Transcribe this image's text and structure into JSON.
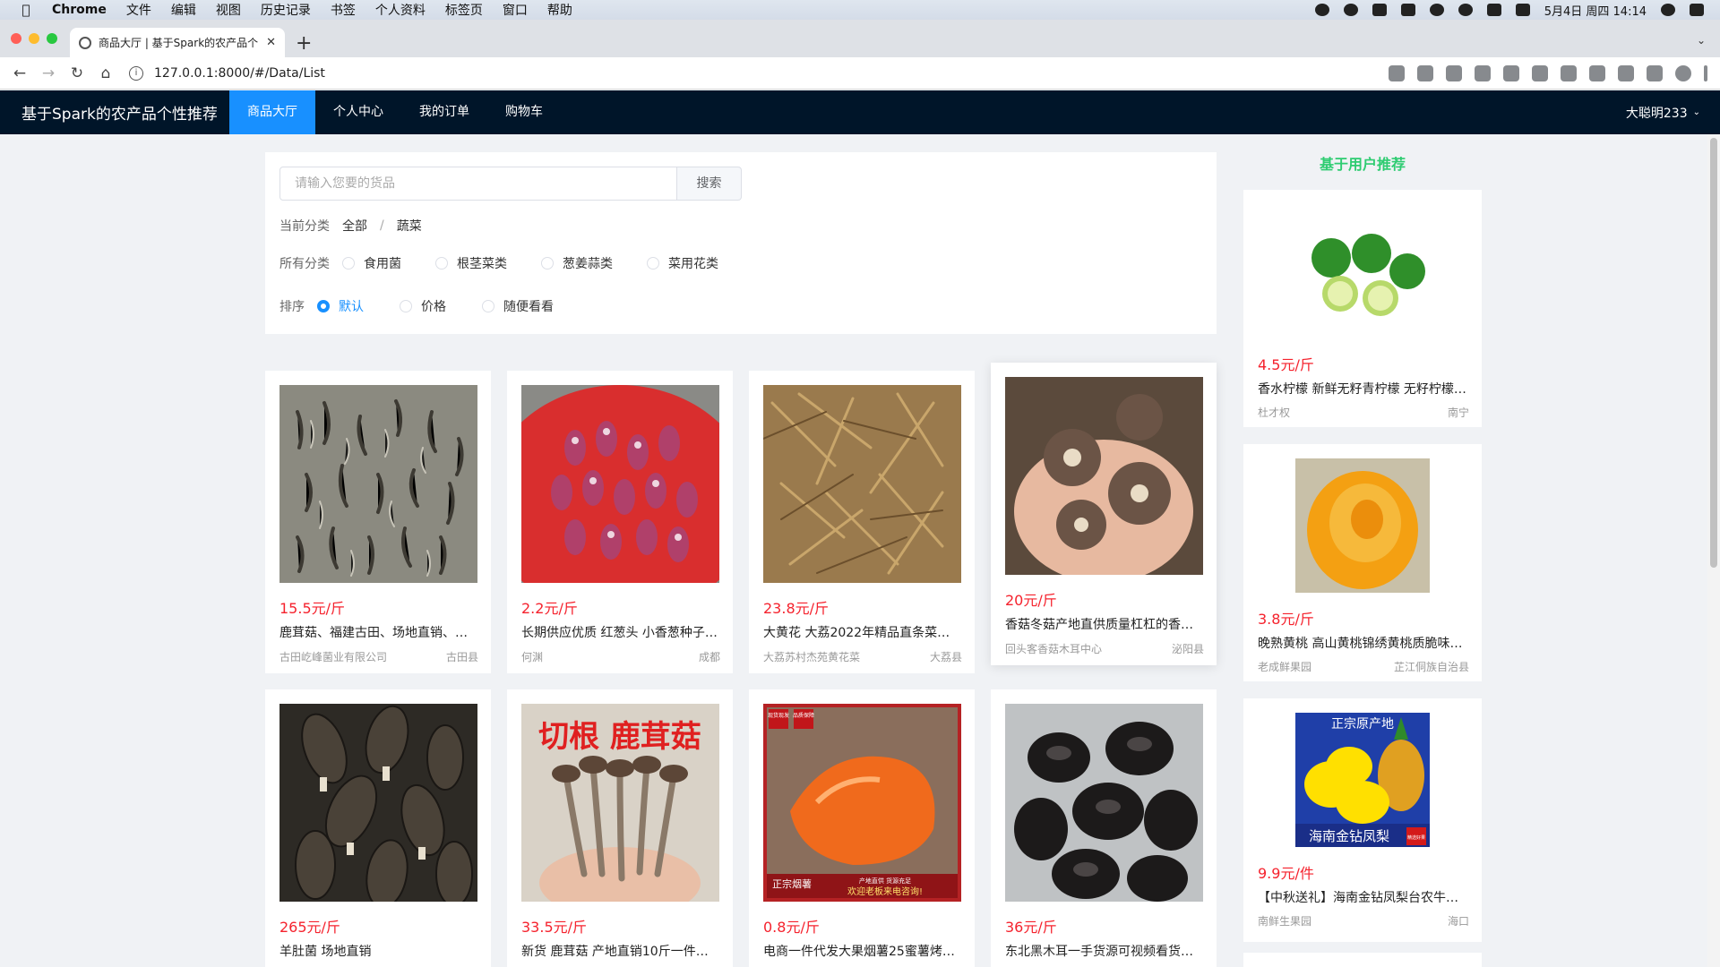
{
  "menubar": {
    "app": "Chrome",
    "items": [
      "文件",
      "编辑",
      "视图",
      "历史记录",
      "书签",
      "个人资料",
      "标签页",
      "窗口",
      "帮助"
    ],
    "clock": "5月4日 周四 14:14"
  },
  "browser": {
    "tab_title": "商品大厅 | 基于Spark的农产品个",
    "url": "127.0.0.1:8000/#/Data/List"
  },
  "nav": {
    "brand": "基于Spark的农产品个性推荐",
    "items": [
      "商品大厅",
      "个人中心",
      "我的订单",
      "购物车"
    ],
    "user": "大聪明233"
  },
  "filter": {
    "search_placeholder": "请输入您要的货品",
    "search_button": "搜索",
    "current_label": "当前分类",
    "crumb_all": "全部",
    "crumb_sep": "/",
    "crumb_current": "蔬菜",
    "all_label": "所有分类",
    "categories": [
      "食用菌",
      "根茎菜类",
      "葱姜蒜类",
      "菜用花类"
    ],
    "sort_label": "排序",
    "sort_options": [
      "默认",
      "价格",
      "随便看看"
    ]
  },
  "products": [
    {
      "price": "15.5元/斤",
      "title": "鹿茸菇、福建古田、场地直销、…",
      "shop": "古田屹峰菌业有限公司",
      "loc": "古田县"
    },
    {
      "price": "2.2元/斤",
      "title": "长期供应优质 红葱头 小香葱种子…",
      "shop": "何渊",
      "loc": "成都"
    },
    {
      "price": "23.8元/斤",
      "title": "大黄花 大荔2022年精品直条菜已…",
      "shop": "大荔苏村杰苑黄花菜",
      "loc": "大荔县"
    },
    {
      "price": "20元/斤",
      "title": "香菇冬菇产地直供质量杠杠的香…",
      "shop": "回头客香菇木耳中心",
      "loc": "泌阳县"
    },
    {
      "price": "265元/斤",
      "title": "羊肚菌 场地直销",
      "shop": "",
      "loc": ""
    },
    {
      "price": "33.5元/斤",
      "title": "新货 鹿茸菇 产地直销10斤一件鲜…",
      "shop": "",
      "loc": ""
    },
    {
      "price": "0.8元/斤",
      "title": "电商一件代发大果烟薯25蜜薯烤…",
      "shop": "",
      "loc": ""
    },
    {
      "price": "36元/斤",
      "title": "东北黑木耳一手货源可视频看货…",
      "shop": "",
      "loc": ""
    }
  ],
  "image_texts": {
    "mushroom_banner": "切根 鹿茸菇",
    "potato_tag1": "现货现发",
    "potato_tag2": "品质保障",
    "potato_bottom": "正宗烟薯",
    "potato_mid": "产地直供 货源充足",
    "potato_caption": "欢迎老板来电咨询!",
    "pineapple_top": "正宗原产地",
    "pineapple_bottom": "海南金钻凤梨",
    "pineapple_badge": "精选好果"
  },
  "recommend": {
    "heading": "基于用户推荐",
    "items": [
      {
        "price": "4.5元/斤",
        "title": "香水柠檬 新鲜无籽青柠檬 无籽柠檬…",
        "shop": "杜才权",
        "loc": "南宁"
      },
      {
        "price": "3.8元/斤",
        "title": "晚熟黄桃 高山黄桃锦绣黄桃质脆味…",
        "shop": "老成鲜果园",
        "loc": "芷江侗族自治县"
      },
      {
        "price": "9.9元/件",
        "title": "【中秋送礼】海南金钻凤梨台农牛…",
        "shop": "南鲜生果园",
        "loc": "海口"
      }
    ]
  },
  "colors": {
    "accent": "#1890ff",
    "header_bg": "#001529",
    "price": "#f5222d",
    "recommend_title": "#2ecc71"
  }
}
